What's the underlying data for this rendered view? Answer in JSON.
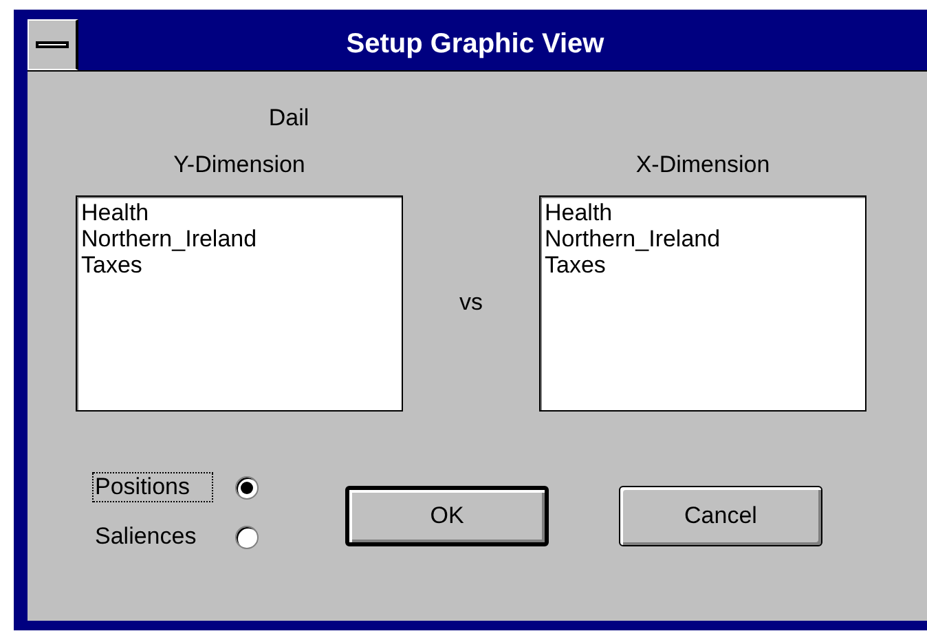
{
  "window": {
    "title": "Setup Graphic View"
  },
  "heading": "Dail",
  "y_dimension": {
    "label": "Y-Dimension",
    "items": [
      "Health",
      "Northern_Ireland",
      "Taxes"
    ]
  },
  "separator": "vs",
  "x_dimension": {
    "label": "X-Dimension",
    "items": [
      "Health",
      "Northern_Ireland",
      "Taxes"
    ]
  },
  "display_options": [
    {
      "label": "Positions",
      "selected": true,
      "focused": true
    },
    {
      "label": "Saliences",
      "selected": false,
      "focused": false
    }
  ],
  "buttons": [
    {
      "label": "OK",
      "default": true
    },
    {
      "label": "Cancel",
      "default": false
    }
  ]
}
